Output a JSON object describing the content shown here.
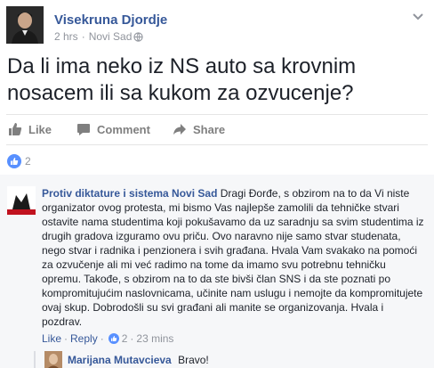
{
  "post": {
    "author": "Visekruna Djordje",
    "time": "2 hrs",
    "location": "Novi Sad",
    "text": "Da li ima neko iz NS auto sa krovnim nosacem ili sa kukom za ozvucenje?"
  },
  "actions": {
    "like": "Like",
    "comment": "Comment",
    "share": "Share"
  },
  "reactions": {
    "count": "2"
  },
  "comment": {
    "author": "Protiv diktature i sistema Novi Sad",
    "text": "Dragi Đorđe, s obzirom na to da Vi niste organizator ovog protesta, mi bismo Vas najlepše zamolili da tehničke stvari ostavite nama studentima koji pokušavamo da uz saradnju sa svim studentima iz drugih gradova izguramo ovu priču. Ovo naravno nije samo stvar studenata, nego stvar i radnika i penzionera i svih građana. Hvala Vam svakako na pomoći za ozvučenje ali mi već radimo na tome da imamo svu potrebnu tehničku opremu. Takođe, s obzirom na to da ste bivši član SNS i da ste poznati po kompromitujućim naslovnicama, učinite nam uslugu i nemojte da kompromitujete ovaj skup. Dobrodošli su svi građani ali manite se organizovanja. Hvala i pozdrav.",
    "like": "Like",
    "reply": "Reply",
    "likes": "2",
    "time": "23 mins"
  },
  "reply": {
    "author": "Marijana Mutavcieva",
    "text": "Bravo!"
  },
  "colors": {
    "link": "#365899",
    "text": "#1d2129",
    "muted": "#90949c",
    "like_blue": "#5890ff"
  }
}
